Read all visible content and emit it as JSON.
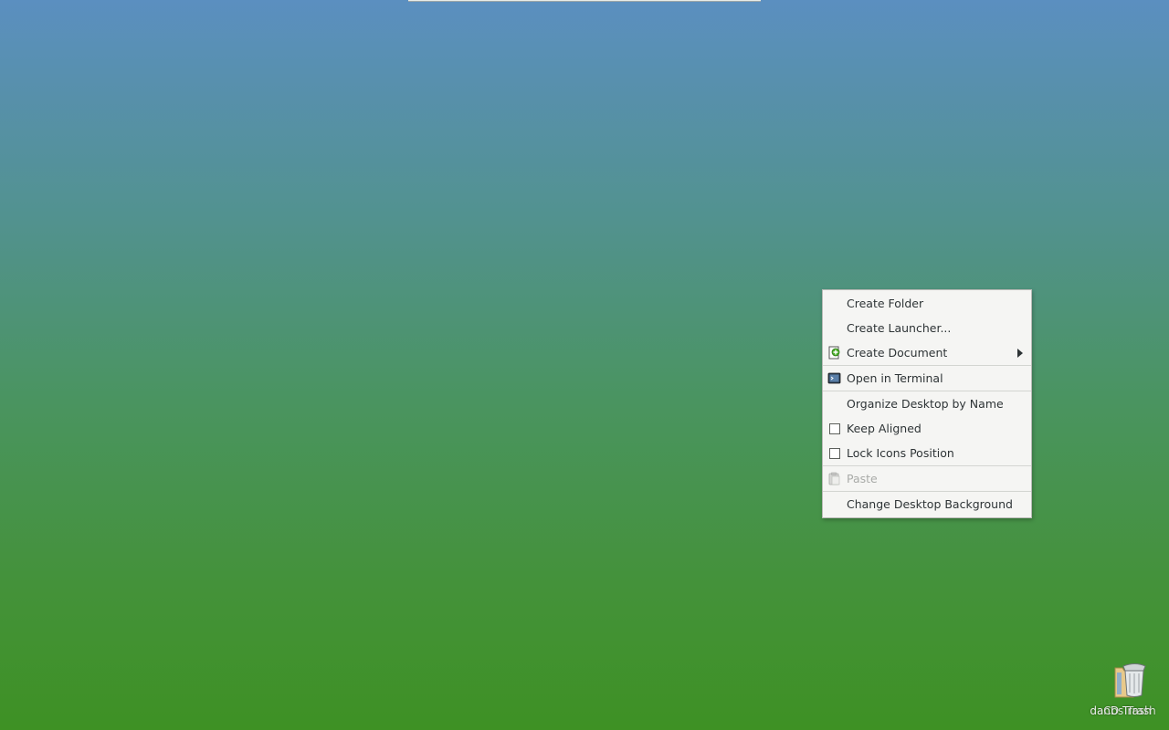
{
  "desktop": {
    "background_top": "#5b8fc0",
    "background_bottom": "#3e9124"
  },
  "context_menu": {
    "items": [
      {
        "label": "Create Folder",
        "icon": null,
        "enabled": true
      },
      {
        "label": "Create Launcher...",
        "icon": null,
        "enabled": true
      },
      {
        "label": "Create Document",
        "icon": "new-document-icon",
        "enabled": true,
        "submenu": true
      },
      {
        "label": "Open in Terminal",
        "icon": "terminal-icon",
        "enabled": true
      },
      {
        "label": "Organize Desktop by Name",
        "icon": null,
        "enabled": true
      },
      {
        "label": "Keep Aligned",
        "icon": "checkbox",
        "checked": false,
        "enabled": true
      },
      {
        "label": "Lock Icons Position",
        "icon": "checkbox",
        "checked": false,
        "enabled": true
      },
      {
        "label": "Paste",
        "icon": "paste-icon",
        "enabled": false
      },
      {
        "label": "Change Desktop Background",
        "icon": null,
        "enabled": true
      }
    ]
  },
  "desktop_icons": [
    {
      "label": "danD Trash",
      "icon": "trash-icon"
    },
    {
      "label": "Cos Trash",
      "icon": "folder-icon"
    }
  ]
}
